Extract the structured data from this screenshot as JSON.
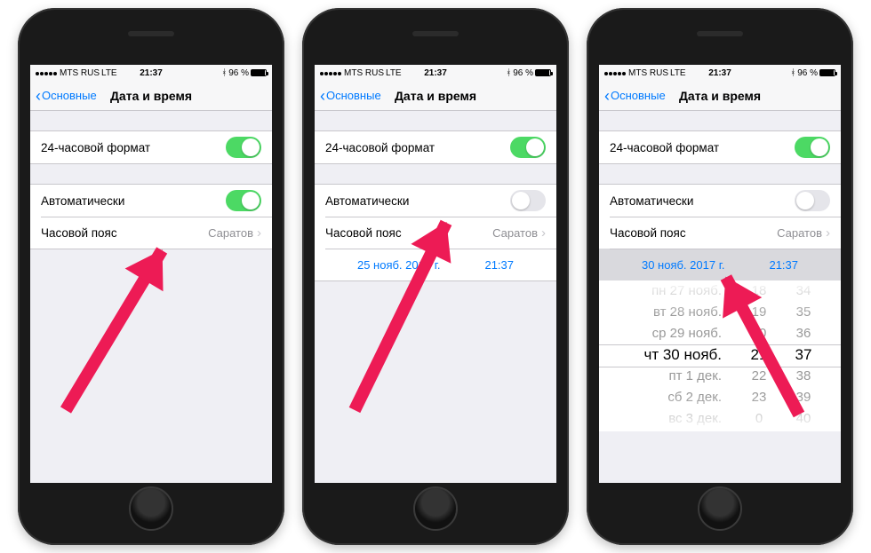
{
  "status": {
    "carrier": "MTS RUS",
    "network": "LTE",
    "time": "21:37",
    "bluetooth": "ᚼ",
    "battery_pct": "96 %"
  },
  "nav": {
    "back": "Основные",
    "title": "Дата и время"
  },
  "rows": {
    "hour24": "24-часовой формат",
    "auto": "Автоматически",
    "timezone": "Часовой пояс",
    "timezone_value": "Саратов"
  },
  "phone2": {
    "date": "25 нояб. 2017 г.",
    "time": "21:37"
  },
  "phone3": {
    "date": "30 нояб. 2017 г.",
    "time": "21:37",
    "picker": {
      "dates": [
        "пн 27 нояб.",
        "вт 28 нояб.",
        "ср 29 нояб.",
        "чт 30 нояб.",
        "пт 1 дек.",
        "сб 2 дек.",
        "вс 3 дек."
      ],
      "hours": [
        "18",
        "19",
        "20",
        "21",
        "22",
        "23",
        "0"
      ],
      "mins": [
        "34",
        "35",
        "36",
        "37",
        "38",
        "39",
        "40"
      ]
    }
  }
}
